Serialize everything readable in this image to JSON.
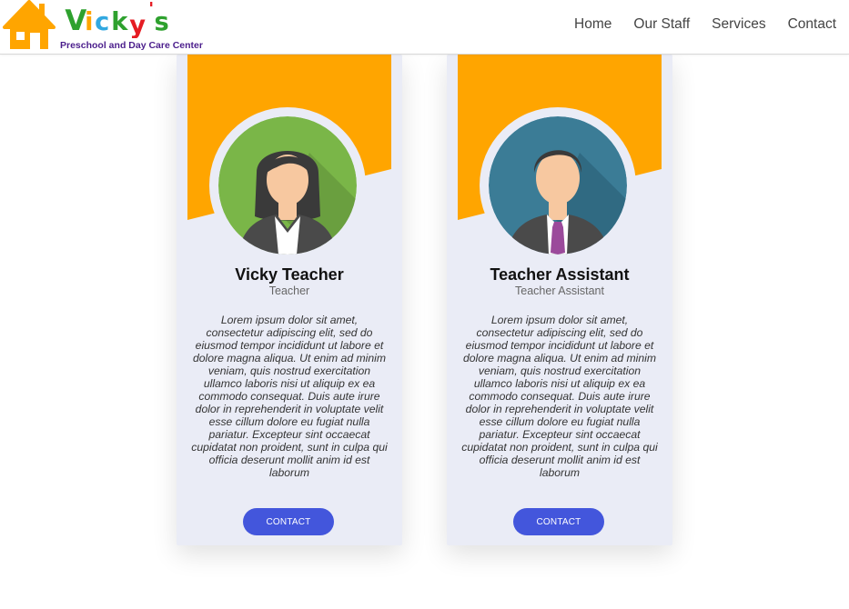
{
  "brand": {
    "name": "Vicky's",
    "tagline": "Preschool and Day Care Center"
  },
  "nav": {
    "items": [
      {
        "label": "Home"
      },
      {
        "label": "Our Staff"
      },
      {
        "label": "Services"
      },
      {
        "label": "Contact"
      }
    ]
  },
  "staff": [
    {
      "name": "Vicky Teacher",
      "role": "Teacher",
      "bio": "Lorem ipsum dolor sit amet, consectetur adipiscing elit, sed do eiusmod tempor incididunt ut labore et dolore magna aliqua. Ut enim ad minim veniam, quis nostrud exercitation ullamco laboris nisi ut aliquip ex ea commodo consequat. Duis aute irure dolor in reprehenderit in voluptate velit esse cillum dolore eu fugiat nulla pariatur. Excepteur sint occaecat cupidatat non proident, sunt in culpa qui officia deserunt mollit anim id est laborum",
      "button": "CONTACT"
    },
    {
      "name": "Teacher Assistant",
      "role": "Teacher Assistant",
      "bio": "Lorem ipsum dolor sit amet, consectetur adipiscing elit, sed do eiusmod tempor incididunt ut labore et dolore magna aliqua. Ut enim ad minim veniam, quis nostrud exercitation ullamco laboris nisi ut aliquip ex ea commodo consequat. Duis aute irure dolor in reprehenderit in voluptate velit esse cillum dolore eu fugiat nulla pariatur. Excepteur sint occaecat cupidatat non proident, sunt in culpa qui officia deserunt mollit anim id est laborum",
      "button": "CONTACT"
    }
  ],
  "colors": {
    "accent": "#ffa500",
    "button": "#4356dc",
    "card_bg": "#eaecf6",
    "female_avatar_bg": "#7ab648",
    "male_avatar_bg": "#3b7c96",
    "tie": "#9b4a9b"
  },
  "icons": {
    "logo": "house-icon",
    "avatar_1": "female-avatar-icon",
    "avatar_2": "male-avatar-icon"
  }
}
